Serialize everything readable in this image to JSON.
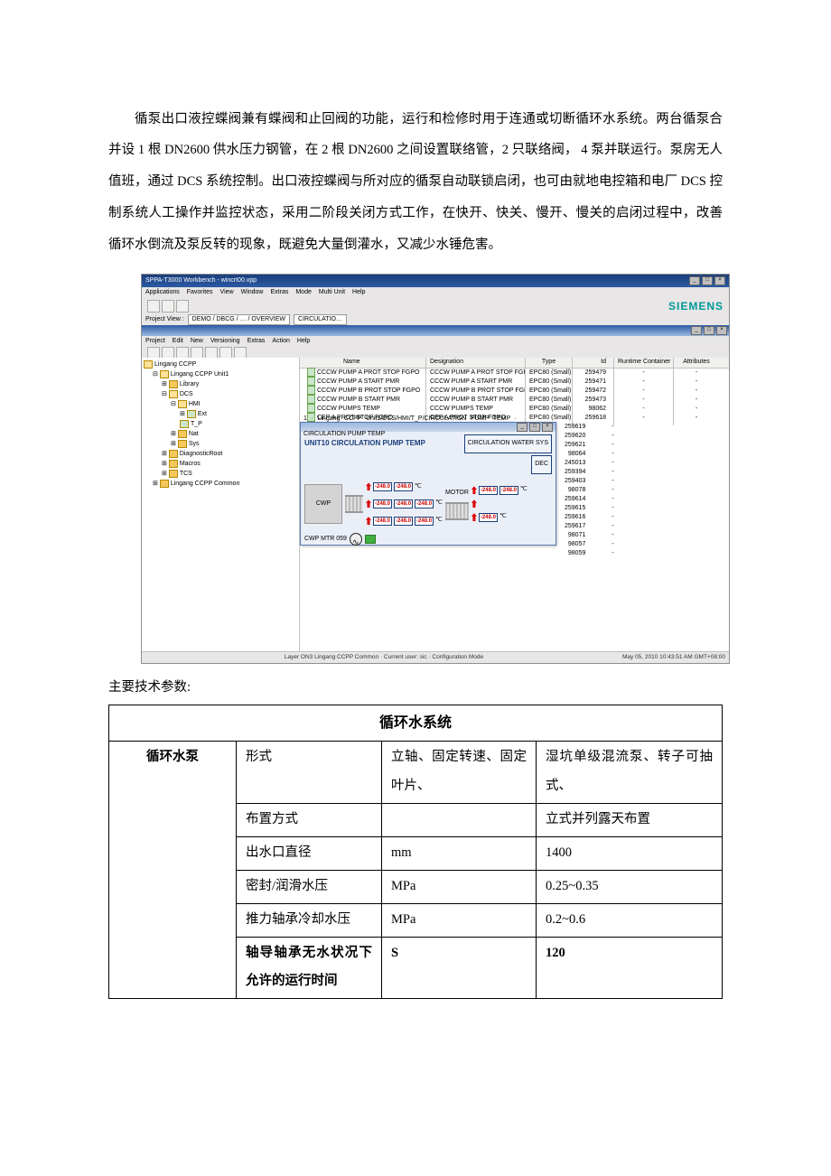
{
  "paragraph": "循泵出口液控蝶阀兼有蝶阀和止回阀的功能，运行和检修时用于连通或切断循环水系统。两台循泵合并设 1 根 DN2600 供水压力钢管，在 2 根 DN2600 之间设置联络管，2 只联络阀， 4 泵并联运行。泵房无人值班，通过 DCS 系统控制。出口液控蝶阀与所对应的循泵自动联锁启闭，也可由就地电控箱和电厂 DCS 控制系统人工操作并监控状态，采用二阶段关闭方式工作，在快开、快关、慢开、慢关的启闭过程中，改善循环水倒流及泵反转的现象，既避免大量倒灌水，又减少水锤危害。",
  "screenshot": {
    "title": "SPPA-T3000 Workbench - wincrt00.vpp",
    "menus": [
      "Applications",
      "Favorites",
      "View",
      "Window",
      "Extras",
      "Mode",
      "Multi Unit",
      "Help"
    ],
    "inner_menus": [
      "Project",
      "Edit",
      "New",
      "Versioning",
      "Extras",
      "Action",
      "Help"
    ],
    "siemens": "SIEMENS",
    "proj_label": "Project View :",
    "proj_path": "DEMO / DBCG / … / OVERVIEW",
    "proj_crumb": "CIRCULATIO…",
    "tree": {
      "root": "Lingang CCPP",
      "items": [
        "Lingang CCPP Unit1",
        "Library",
        "DCS",
        "HMI",
        "Ext",
        "Nat",
        "Sys",
        "DiagnosticRoot",
        "Macros",
        "TCS",
        "Lingang CCPP Common"
      ]
    },
    "list": {
      "headers": [
        "Name",
        "Designation",
        "Type",
        "Id",
        "Runtime Container",
        "Attributes"
      ],
      "rows": [
        {
          "name": "CCCW PUMP A PROT STOP FGPO",
          "desig": "CCCW PUMP A  PROT STOP FGPO",
          "type": "EPC80 (Small)",
          "id": "259479"
        },
        {
          "name": "CCCW PUMP A START PMR",
          "desig": "CCCW PUMP A START PMR",
          "type": "EPC80 (Small)",
          "id": "259471"
        },
        {
          "name": "CCCW PUMP B PROT STOP FGPO",
          "desig": "CCCW PUMP B  PROT STOP FGPO",
          "type": "EPC80 (Small)",
          "id": "259472"
        },
        {
          "name": "CCCW PUMP B START PMR",
          "desig": "CCCW PUMP B START PMR",
          "type": "EPC80 (Small)",
          "id": "259473"
        },
        {
          "name": "CCCW PUMPS TEMP",
          "desig": "CCCW PUMPS TEMP",
          "type": "EPC80 (Small)",
          "id": "98062"
        },
        {
          "name": "CEP A PROT STOP FGPO",
          "desig": "CEP A  PROT STOP FGPO",
          "type": "EPC80 (Small)",
          "id": "259618"
        }
      ],
      "extra_ids": [
        "259619",
        "259620",
        "259621",
        "98064",
        "245013",
        "259394",
        "259403",
        "98078",
        "259614",
        "259615",
        "259616",
        "259617",
        "98071",
        "98057",
        "98059"
      ]
    },
    "popup": {
      "title": "1 · Lingang CCPP Unit1/DCS/HMI/T_P/CIRCULATION PUMP TEMP · CIRCULATION PUMP TEMP",
      "heading": "UNIT10 CIRCULATION PUMP TEMP",
      "btn1": "CIRCULATION WATER SYS",
      "btn2": "DEC",
      "motor": "MOTOR",
      "cwp": "CWP",
      "value": "-248.0",
      "unit_c": "℃",
      "mtr": "CWP MTR 059"
    },
    "status_left": "Layer ON3 Lingang CCPP Common · Current user: sic · Configuration Mode",
    "status_right": "May 05, 2010 10:43:51 AM GMT+08:00"
  },
  "section_label": "主要技术参数:",
  "table": {
    "title": "循环水系统",
    "rowhead": "循环水泵",
    "rows": [
      {
        "p": "形式",
        "u": "立轴、固定转速、固定叶片、",
        "v": "湿坑单级混流泵、转子可抽式、"
      },
      {
        "p": "布置方式",
        "u": "",
        "v": "立式并列露天布置"
      },
      {
        "p": "出水口直径",
        "u": "mm",
        "v": "1400"
      },
      {
        "p": "密封/润滑水压",
        "u": "MPa",
        "v": "0.25~0.35"
      },
      {
        "p": "推力轴承冷却水压",
        "u": "MPa",
        "v": "0.2~0.6"
      },
      {
        "p": "轴导轴承无水状况下允许的运行时间",
        "u": "S",
        "v": "120",
        "bold": true
      }
    ]
  }
}
